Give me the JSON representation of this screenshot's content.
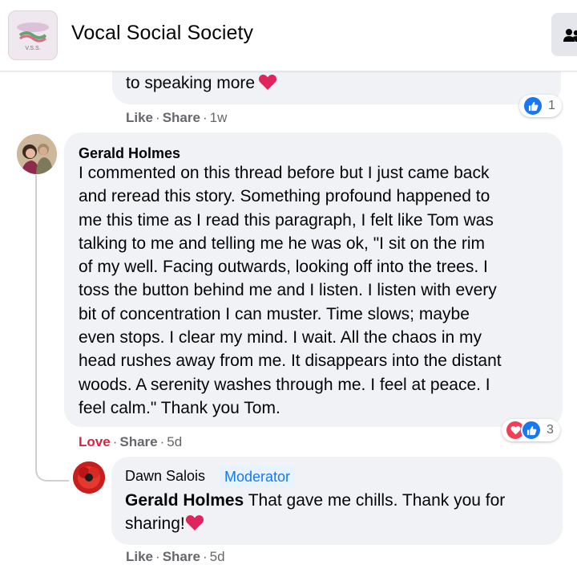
{
  "header": {
    "group_name": "Vocal Social Society",
    "logo_text": "V.S.S."
  },
  "comments": [
    {
      "text": "to speaking more",
      "actions": {
        "like": "Like",
        "share": "Share",
        "time": "1w"
      },
      "reactions": {
        "icons": [
          "like-icon"
        ],
        "count": "1"
      }
    },
    {
      "author": "Gerald Holmes",
      "lines": [
        "I commented on this thread before but I just came back",
        "and reread this story. Something profound happened to",
        "me this time as I read this paragraph, I felt like Tom was",
        "talking to me and telling me he was ok, \"I sit on the rim",
        "of my well. Facing outwards, looking off into the trees. I",
        "toss the button behind me and I listen. I listen with every",
        "bit of concentration I can muster. Time slows; maybe",
        "even stops. I clear my mind. I wait. All the chaos in my",
        "head rushes away from me. It disappears into the distant",
        "woods. A serenity washes through me. I feel at peace. I",
        "feel calm.\" Thank you Tom."
      ],
      "actions": {
        "like": "Love",
        "share": "Share",
        "time": "5d"
      },
      "reactions": {
        "icons": [
          "love-icon",
          "like-icon"
        ],
        "count": "3"
      }
    },
    {
      "author": "Dawn Salois",
      "badge": "Moderator",
      "mention": "Gerald Holmes",
      "text_line1": " That gave me chills. Thank you for",
      "text_line2": "sharing!",
      "actions": {
        "like": "Like",
        "share": "Share",
        "time": "5d"
      }
    }
  ],
  "colors": {
    "bubble": "#f0f2f5",
    "like_blue": "#1877f2",
    "love_red": "#e41e3f",
    "meta_gray": "#65676b",
    "moderator_bg": "#e7f3ff"
  }
}
